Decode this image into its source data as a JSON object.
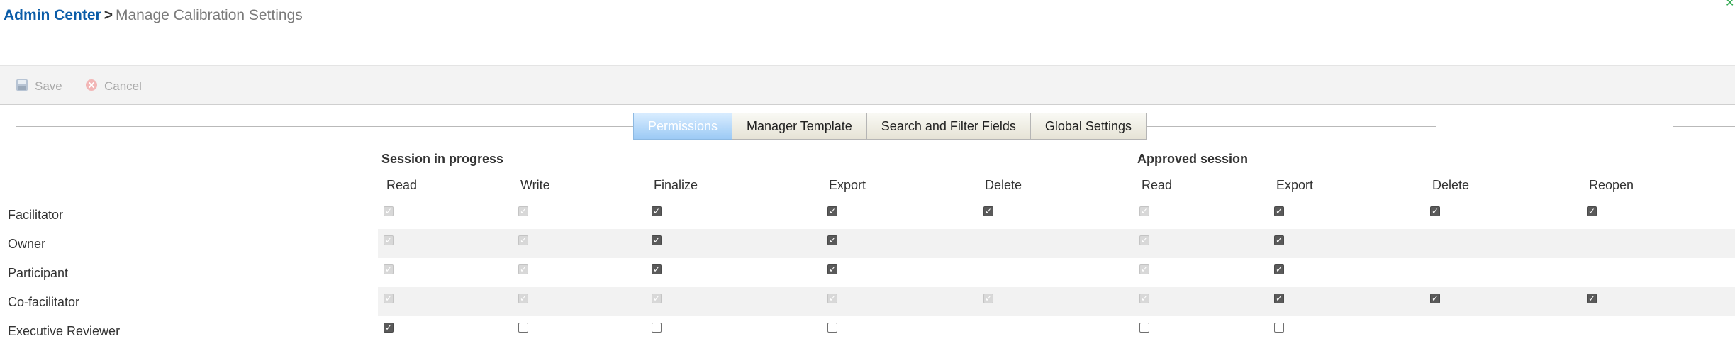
{
  "breadcrumb": {
    "root": "Admin Center",
    "separator": ">",
    "current": "Manage Calibration Settings"
  },
  "toolbar": {
    "save_label": "Save",
    "cancel_label": "Cancel"
  },
  "tabs": [
    {
      "label": "Permissions",
      "active": true
    },
    {
      "label": "Manager Template",
      "active": false
    },
    {
      "label": "Search and Filter Fields",
      "active": false
    },
    {
      "label": "Global Settings",
      "active": false
    }
  ],
  "groups": {
    "in_progress": "Session in progress",
    "approved": "Approved session"
  },
  "columns": {
    "ip_read": "Read",
    "ip_write": "Write",
    "ip_finalize": "Finalize",
    "ip_export": "Export",
    "ip_delete": "Delete",
    "ap_read": "Read",
    "ap_export": "Export",
    "ap_delete": "Delete",
    "ap_reopen": "Reopen"
  },
  "rows": [
    {
      "label": "Facilitator",
      "shaded": false,
      "states": {
        "ip_read": "disabled",
        "ip_write": "disabled",
        "ip_finalize": "checked",
        "ip_export": "checked",
        "ip_delete": "checked",
        "ap_read": "disabled",
        "ap_export": "checked",
        "ap_delete": "checked",
        "ap_reopen": "checked"
      }
    },
    {
      "label": "Owner",
      "shaded": true,
      "states": {
        "ip_read": "disabled",
        "ip_write": "disabled",
        "ip_finalize": "checked",
        "ip_export": "checked",
        "ap_read": "disabled",
        "ap_export": "checked"
      }
    },
    {
      "label": "Participant",
      "shaded": false,
      "states": {
        "ip_read": "disabled",
        "ip_write": "disabled",
        "ip_finalize": "checked",
        "ip_export": "checked",
        "ap_read": "disabled",
        "ap_export": "checked"
      }
    },
    {
      "label": "Co-facilitator",
      "shaded": true,
      "states": {
        "ip_read": "disabled",
        "ip_write": "disabled",
        "ip_finalize": "disabled",
        "ip_export": "disabled",
        "ip_delete": "disabled",
        "ap_read": "disabled",
        "ap_export": "checked",
        "ap_delete": "checked",
        "ap_reopen": "checked"
      }
    },
    {
      "label": "Executive Reviewer",
      "shaded": false,
      "states": {
        "ip_read": "checked",
        "ip_write": "unchecked",
        "ip_finalize": "unchecked",
        "ip_export": "unchecked",
        "ap_read": "unchecked",
        "ap_export": "unchecked"
      }
    }
  ]
}
